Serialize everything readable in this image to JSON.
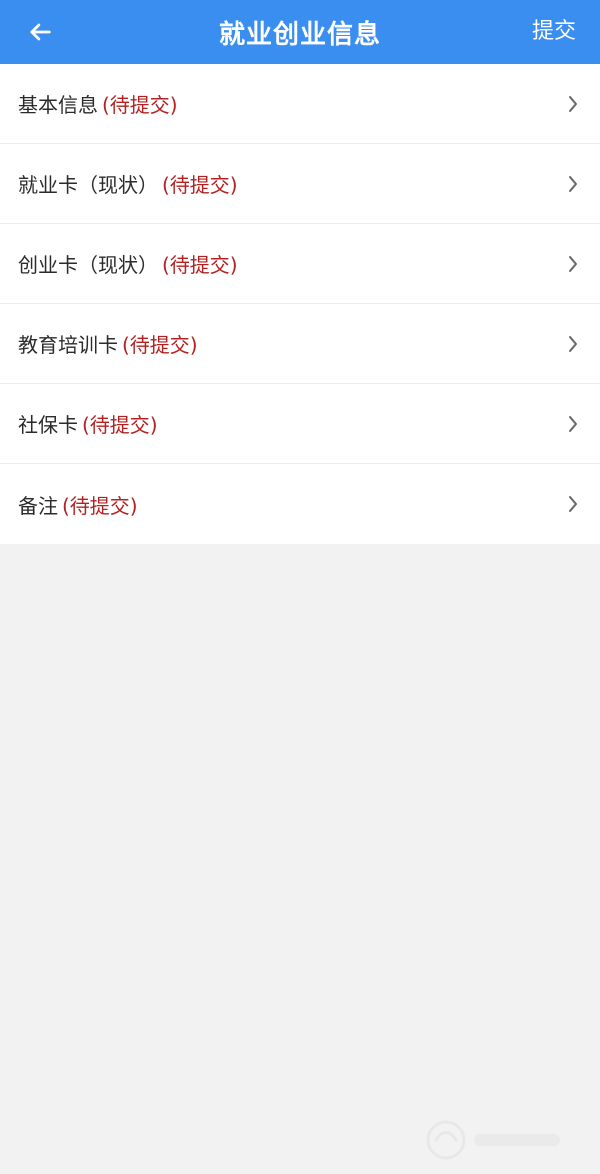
{
  "header": {
    "title": "就业创业信息",
    "submit_label": "提交",
    "back_icon": "arrow-left-icon",
    "background_color": "#3a8ef0"
  },
  "list": {
    "items": [
      {
        "label": "基本信息",
        "status": "(待提交)",
        "chevron_icon": "chevron-right-icon"
      },
      {
        "label": "就业卡（现状）",
        "status": "(待提交)",
        "chevron_icon": "chevron-right-icon"
      },
      {
        "label": "创业卡（现状）",
        "status": "(待提交)",
        "chevron_icon": "chevron-right-icon"
      },
      {
        "label": "教育培训卡",
        "status": "(待提交)",
        "chevron_icon": "chevron-right-icon"
      },
      {
        "label": "社保卡",
        "status": "(待提交)",
        "chevron_icon": "chevron-right-icon"
      },
      {
        "label": "备注",
        "status": "(待提交)",
        "chevron_icon": "chevron-right-icon"
      }
    ],
    "status_color": "#b22222"
  }
}
